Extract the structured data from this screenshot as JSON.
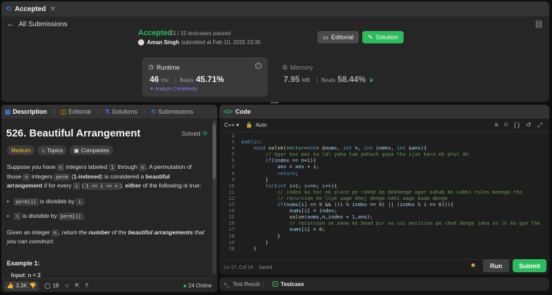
{
  "top_tab": {
    "label": "Accepted",
    "close": "✕"
  },
  "submission": {
    "back_label": "All Submissions",
    "status": "Accepted",
    "testcases": "15 / 15 testcases passed",
    "user": "Aman Singh",
    "submitted_text": "submitted at Feb 10, 2025 23:35",
    "editorial_label": "Editorial",
    "solution_label": "Solution",
    "runtime": {
      "title": "Runtime",
      "value": "46",
      "unit": "ms",
      "beats_label": "Beats",
      "beats_pct": "45.71%",
      "analyze_label": "Analyze Complexity"
    },
    "memory": {
      "title": "Memory",
      "value": "7.95",
      "unit": "MB",
      "beats_label": "Beats",
      "beats_pct": "58.44%"
    }
  },
  "left_tabs": [
    "Description",
    "Editorial",
    "Solutions",
    "Submissions"
  ],
  "problem": {
    "title": "526. Beautiful Arrangement",
    "solved": "Solved",
    "difficulty": "Medium",
    "topics": "Topics",
    "companies": "Companies",
    "p1_a": "Suppose you have ",
    "p1_n": "n",
    "p1_b": " integers labeled ",
    "p1_1": "1",
    "p1_c": " through ",
    "p1_n2": "n",
    "p1_d": ". A permutation of those ",
    "p1_n3": "n",
    "p1_e": " integers ",
    "p1_perm": "perm",
    "p1_f": " (",
    "p1_indexed": "1-indexed",
    "p1_g": ") is considered a ",
    "p1_beautiful": "beautiful arrangement",
    "p1_h": " if for every ",
    "p1_i": "i",
    "p1_j": " (",
    "p1_range": "1 <= i <= n",
    "p1_k": "), ",
    "p1_either": "either",
    "p1_l": " of the following is true:",
    "b1_code": "perm[i]",
    "b1_text": " is divisible by ",
    "b1_i": "i",
    "b1_end": ".",
    "b2_code": "i",
    "b2_text": " is divisible by ",
    "b2_perm": "perm[i]",
    "b2_end": ".",
    "p2_a": "Given an integer ",
    "p2_n": "n",
    "p2_b": ", return the ",
    "p2_number": "number",
    "p2_c": " of the ",
    "p2_beautiful": "beautiful arrangements",
    "p2_d": " that you can construct.",
    "example_title": "Example 1:",
    "example_cut": "Input: n = 2"
  },
  "footer": {
    "likes": "3.3K",
    "comments": "18",
    "online": "24 Online"
  },
  "code": {
    "tab_label": "Code",
    "language": "C++",
    "mode": "Auto",
    "line_numbers": [
      "2",
      "3",
      "4",
      "5",
      "6",
      "7",
      "8",
      "9",
      "10",
      "11",
      "12",
      "13",
      "14",
      "15",
      "16",
      "17",
      "18",
      "19",
      "20"
    ],
    "status_pos": "Ln 17, Col 14",
    "status_saved": "Saved",
    "run_label": "Run",
    "submit_label": "Submit"
  },
  "result_tabs": {
    "test_result": "Test Result",
    "testcase": "Testcase"
  },
  "colors": {
    "accent_green": "#2cbb5d",
    "medium": "#ffc01e",
    "panel": "#262626"
  }
}
